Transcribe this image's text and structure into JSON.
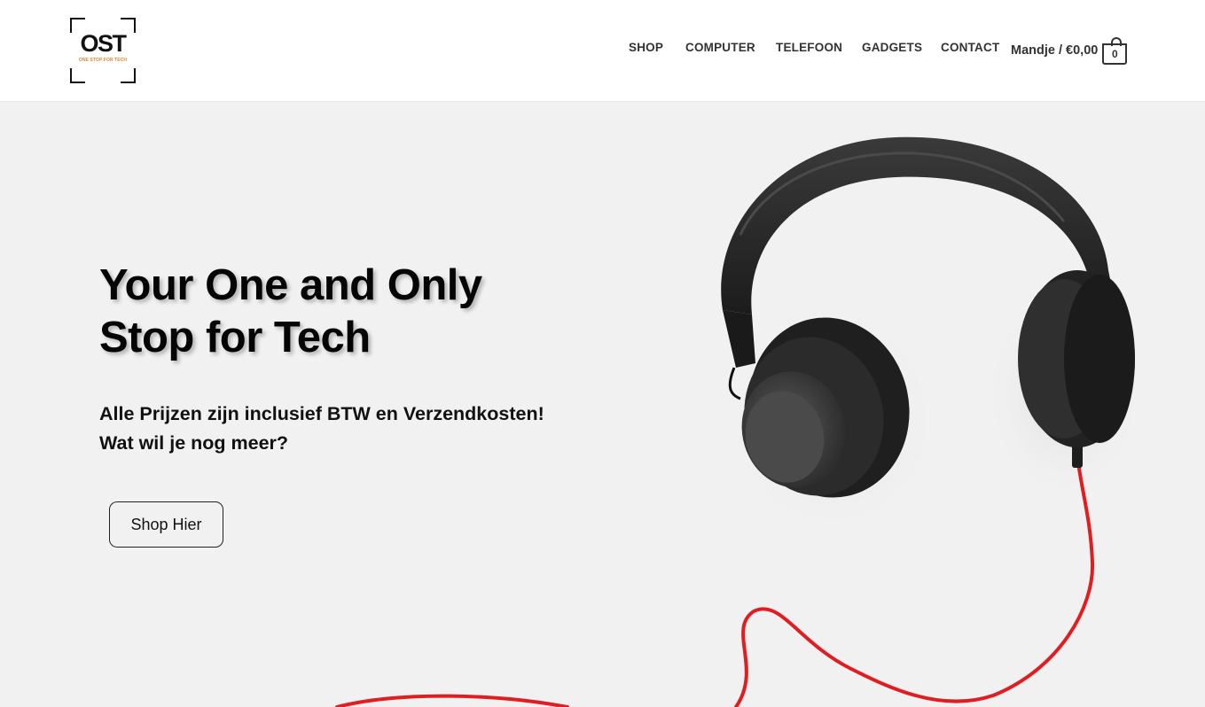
{
  "brand": {
    "logo_text": "OST",
    "tagline": "ONE STOP FOR TECH"
  },
  "nav": {
    "items": [
      {
        "label": "SHOP"
      },
      {
        "label": "COMPUTER"
      },
      {
        "label": "TELEFOON"
      },
      {
        "label": "GADGETS"
      },
      {
        "label": "CONTACT"
      }
    ]
  },
  "cart": {
    "label": "Mandje / €0,00",
    "count": "0"
  },
  "hero": {
    "title_line1": "Your One and Only",
    "title_line2": "Stop for Tech",
    "subtitle_line1": "Alle Prijzen zijn inclusief BTW en Verzendkosten!",
    "subtitle_line2": "Wat wil je nog meer?",
    "button_label": "Shop Hier",
    "image": "headphones-with-red-cable"
  },
  "colors": {
    "header_bg": "#ffffff",
    "hero_bg": "#f1f1f1",
    "accent_orange": "#e8862a",
    "cable_red": "#e11d22",
    "text": "#111111"
  }
}
